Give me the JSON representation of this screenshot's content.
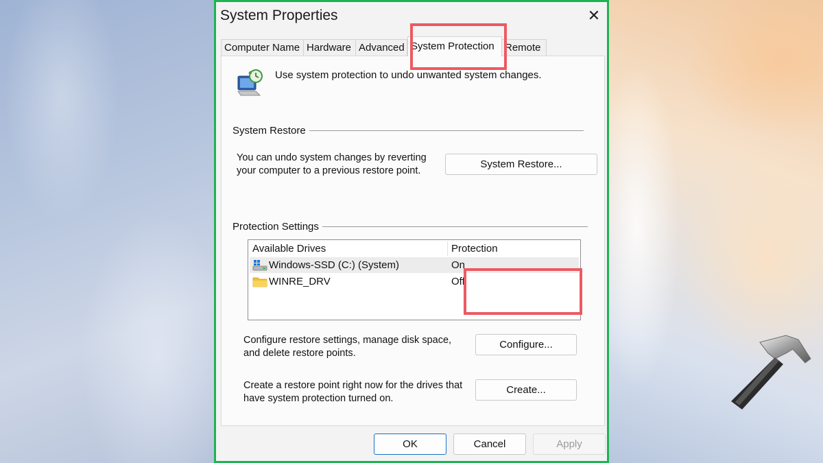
{
  "window": {
    "title": "System Properties",
    "close_symbol": "✕"
  },
  "tabs": [
    {
      "label": "Computer Name",
      "active": false
    },
    {
      "label": "Hardware",
      "active": false
    },
    {
      "label": "Advanced",
      "active": false
    },
    {
      "label": "System Protection",
      "active": true
    },
    {
      "label": "Remote",
      "active": false
    }
  ],
  "header": {
    "icon": "system-protection-icon",
    "text": "Use system protection to undo unwanted system changes."
  },
  "system_restore": {
    "group_label": "System Restore",
    "description_line1": "You can undo system changes by reverting",
    "description_line2": "your computer to a previous restore point.",
    "button_label": "System Restore..."
  },
  "protection_settings": {
    "group_label": "Protection Settings",
    "columns": [
      "Available Drives",
      "Protection"
    ],
    "drives": [
      {
        "name": "Windows-SSD (C:) (System)",
        "protection": "On",
        "icon": "windows-drive-icon",
        "selected": true
      },
      {
        "name": "WINRE_DRV",
        "protection": "Off",
        "icon": "folder-drive-icon",
        "selected": false
      }
    ],
    "configure_text_line1": "Configure restore settings, manage disk space,",
    "configure_text_line2": "and delete restore points.",
    "configure_button": "Configure...",
    "create_text_line1": "Create a restore point right now for the drives that",
    "create_text_line2": "have system protection turned on.",
    "create_button": "Create..."
  },
  "footer": {
    "ok": "OK",
    "cancel": "Cancel",
    "apply": "Apply"
  },
  "colors": {
    "dialog_border": "#1db354",
    "highlight": "#ec5a62",
    "default_button_border": "#1a72c8"
  }
}
